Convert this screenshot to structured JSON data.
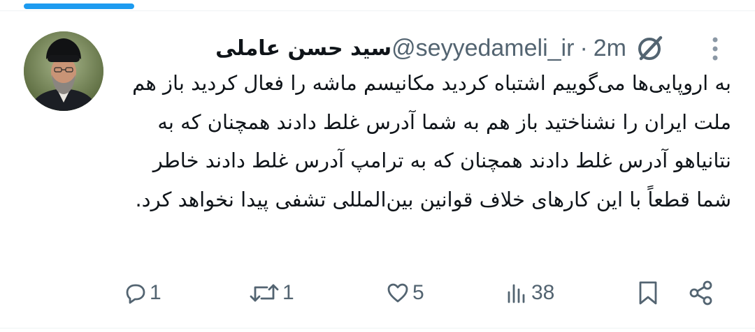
{
  "tweet": {
    "author_name": "سید حسن عاملی",
    "handle": "@seyyedameli_ir",
    "separator": "·",
    "timestamp": "2m",
    "text": "به اروپایی‌ها می‌گوییم اشتباه کردید مکانیسم ماشه را فعال کردید باز هم ملت ایران را نشناختید باز هم به شما آدرس غلط دادند همچنان که به نتانیاهو آدرس غلط دادند همچنان که به ترامپ آدرس غلط دادند خاطر شما قطعاً با این کارهای خلاف قوانین بین‌المللی تشفی پیدا نخواهد کرد."
  },
  "actions": {
    "reply_count": "1",
    "retweet_count": "1",
    "like_count": "5",
    "views_count": "38"
  },
  "icons": {
    "header": [
      "grok-icon",
      "more-options-icon"
    ],
    "actions": [
      "reply-icon",
      "retweet-icon",
      "like-icon",
      "views-icon",
      "bookmark-icon",
      "share-icon"
    ]
  },
  "colors": {
    "accent": "#1d9bf0",
    "secondary_text": "#536471",
    "primary_text": "#0f1419"
  }
}
